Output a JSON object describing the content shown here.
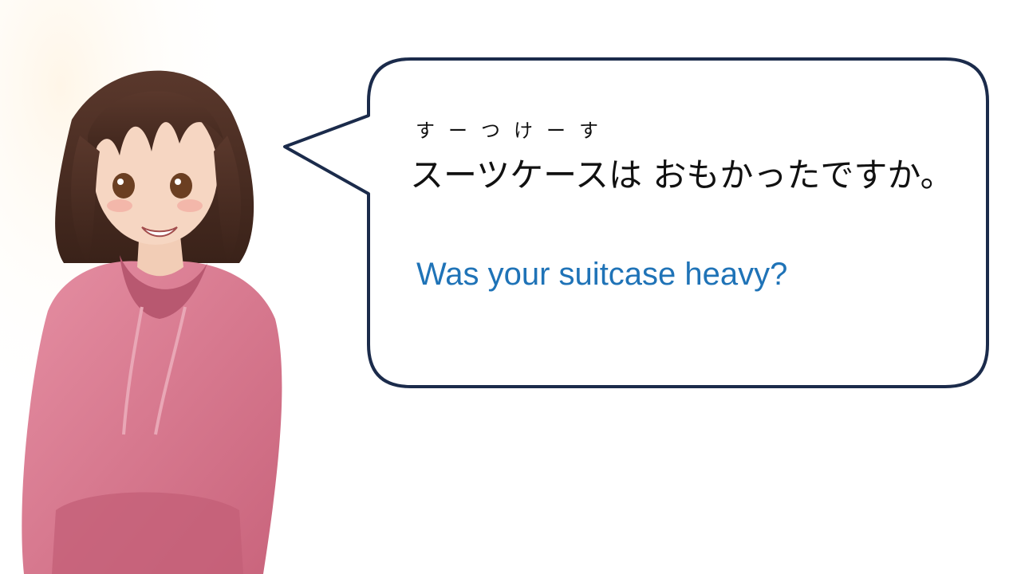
{
  "dialogue": {
    "furigana": "すーつけーす",
    "japanese": "スーツケースは おもかったですか。",
    "english": "Was your suitcase heavy?"
  },
  "colors": {
    "bubble_border": "#1b2b4b",
    "english_text": "#1f73b7",
    "hoodie": "#d9798f",
    "hair": "#4a2c22"
  },
  "character": {
    "description_icon": "girl-in-pink-hoodie-illustration"
  }
}
